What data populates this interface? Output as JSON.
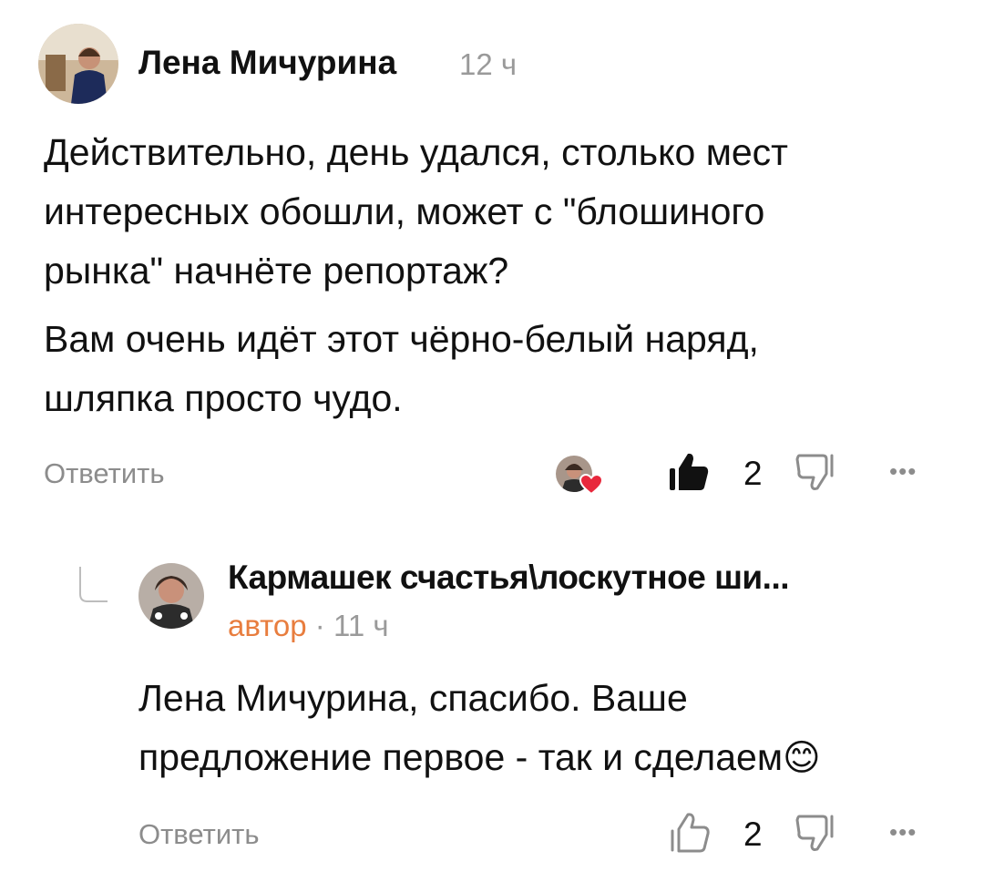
{
  "comment": {
    "author": "Лена Мичурина",
    "time": "12 ч",
    "paragraphs": [
      "Действительно, день удался, столько мест интересных обошли, может с \"блошиного рынка\" начнёте репортаж?",
      "Вам очень идёт этот чёрно-белый наряд, шляпка просто чудо."
    ],
    "reply_label": "Ответить",
    "like_count": "2",
    "liked": true,
    "author_liked": true,
    "more_label": "•••"
  },
  "reply": {
    "author": "Кармашек счастья\\лоскутное ши...",
    "badge": "автор",
    "separator": "·",
    "time": "11 ч",
    "text": "Лена Мичурина, спасибо. Ваше предложение первое - так и сделаем",
    "emoji": "😊",
    "reply_label": "Ответить",
    "like_count": "2",
    "liked": false,
    "more_label": "•••"
  },
  "colors": {
    "badge": "#e87d3e",
    "heart": "#e8283c",
    "muted": "#8c8c8c"
  }
}
